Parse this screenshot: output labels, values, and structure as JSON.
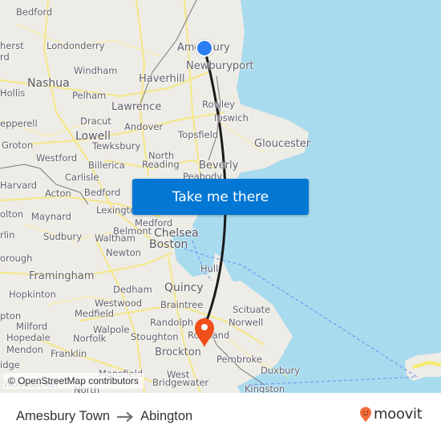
{
  "map": {
    "attribution": "© OpenStreetMap contributors",
    "places": [
      {
        "name": "Bedford",
        "cls": ""
      },
      {
        "name": "Londonderry",
        "cls": ""
      },
      {
        "name": "herst",
        "cls": ""
      },
      {
        "name": "rd",
        "cls": ""
      },
      {
        "name": "Windham",
        "cls": ""
      },
      {
        "name": "Nashua",
        "cls": "big"
      },
      {
        "name": "Haverhill",
        "cls": "med"
      },
      {
        "name": "Hollis",
        "cls": ""
      },
      {
        "name": "Pelham",
        "cls": ""
      },
      {
        "name": "Lawrence",
        "cls": "med"
      },
      {
        "name": "Amesbury",
        "cls": "med"
      },
      {
        "name": "Newburyport",
        "cls": "med"
      },
      {
        "name": "Rowley",
        "cls": ""
      },
      {
        "name": "Ipswich",
        "cls": ""
      },
      {
        "name": "epperell",
        "cls": ""
      },
      {
        "name": "Dracut",
        "cls": ""
      },
      {
        "name": "Andover",
        "cls": ""
      },
      {
        "name": "Topsfield",
        "cls": ""
      },
      {
        "name": "Groton",
        "cls": ""
      },
      {
        "name": "Lowell",
        "cls": "big"
      },
      {
        "name": "Tewksbury",
        "cls": ""
      },
      {
        "name": "Gloucester",
        "cls": "med"
      },
      {
        "name": "Westford",
        "cls": ""
      },
      {
        "name": "North",
        "cls": ""
      },
      {
        "name": "Reading",
        "cls": ""
      },
      {
        "name": "Billerica",
        "cls": ""
      },
      {
        "name": "Beverly",
        "cls": "med"
      },
      {
        "name": "Carlisle",
        "cls": ""
      },
      {
        "name": "Peabody",
        "cls": ""
      },
      {
        "name": "Harvard",
        "cls": ""
      },
      {
        "name": "Acton",
        "cls": ""
      },
      {
        "name": "Bedford",
        "cls": ""
      },
      {
        "name": "Lexington",
        "cls": ""
      },
      {
        "name": "olton",
        "cls": ""
      },
      {
        "name": "Maynard",
        "cls": ""
      },
      {
        "name": "Medford",
        "cls": ""
      },
      {
        "name": "Belmont",
        "cls": ""
      },
      {
        "name": "Chelsea",
        "cls": "big"
      },
      {
        "name": "rlin",
        "cls": ""
      },
      {
        "name": "Sudbury",
        "cls": ""
      },
      {
        "name": "Waltham",
        "cls": ""
      },
      {
        "name": "Boston",
        "cls": "big"
      },
      {
        "name": "Newton",
        "cls": ""
      },
      {
        "name": "orough",
        "cls": ""
      },
      {
        "name": "Hull",
        "cls": ""
      },
      {
        "name": "Framingham",
        "cls": "med"
      },
      {
        "name": "Dedham",
        "cls": ""
      },
      {
        "name": "Quincy",
        "cls": "big"
      },
      {
        "name": "Hopkinton",
        "cls": ""
      },
      {
        "name": "Westwood",
        "cls": ""
      },
      {
        "name": "Braintree",
        "cls": ""
      },
      {
        "name": "Scituate",
        "cls": ""
      },
      {
        "name": "Medfield",
        "cls": ""
      },
      {
        "name": "pton",
        "cls": ""
      },
      {
        "name": "Randolph",
        "cls": ""
      },
      {
        "name": "Norwell",
        "cls": ""
      },
      {
        "name": "Milford",
        "cls": ""
      },
      {
        "name": "Walpole",
        "cls": ""
      },
      {
        "name": "Stoughton",
        "cls": ""
      },
      {
        "name": "Rockland",
        "cls": ""
      },
      {
        "name": "Hopedale",
        "cls": ""
      },
      {
        "name": "Norfolk",
        "cls": ""
      },
      {
        "name": "Mendon",
        "cls": ""
      },
      {
        "name": "Franklin",
        "cls": ""
      },
      {
        "name": "Brockton",
        "cls": "med"
      },
      {
        "name": "Pembroke",
        "cls": ""
      },
      {
        "name": "idge",
        "cls": ""
      },
      {
        "name": "Duxbury",
        "cls": ""
      },
      {
        "name": "Mansfield",
        "cls": ""
      },
      {
        "name": "West",
        "cls": ""
      },
      {
        "name": "Bridgewater",
        "cls": ""
      },
      {
        "name": "Woonsocket",
        "cls": ""
      },
      {
        "name": "North",
        "cls": ""
      },
      {
        "name": "Kingston",
        "cls": ""
      }
    ]
  },
  "cta": {
    "label": "Take me there"
  },
  "route": {
    "origin": "Amesbury Town",
    "destination": "Abington"
  },
  "brand": {
    "name": "moovit",
    "color": "#f26c3a"
  },
  "colors": {
    "accent": "#0277d4",
    "origin_marker": "#2c7ff3",
    "destination_marker": "#f04e1a",
    "water": "#a9dbef",
    "land": "#eeece6"
  }
}
